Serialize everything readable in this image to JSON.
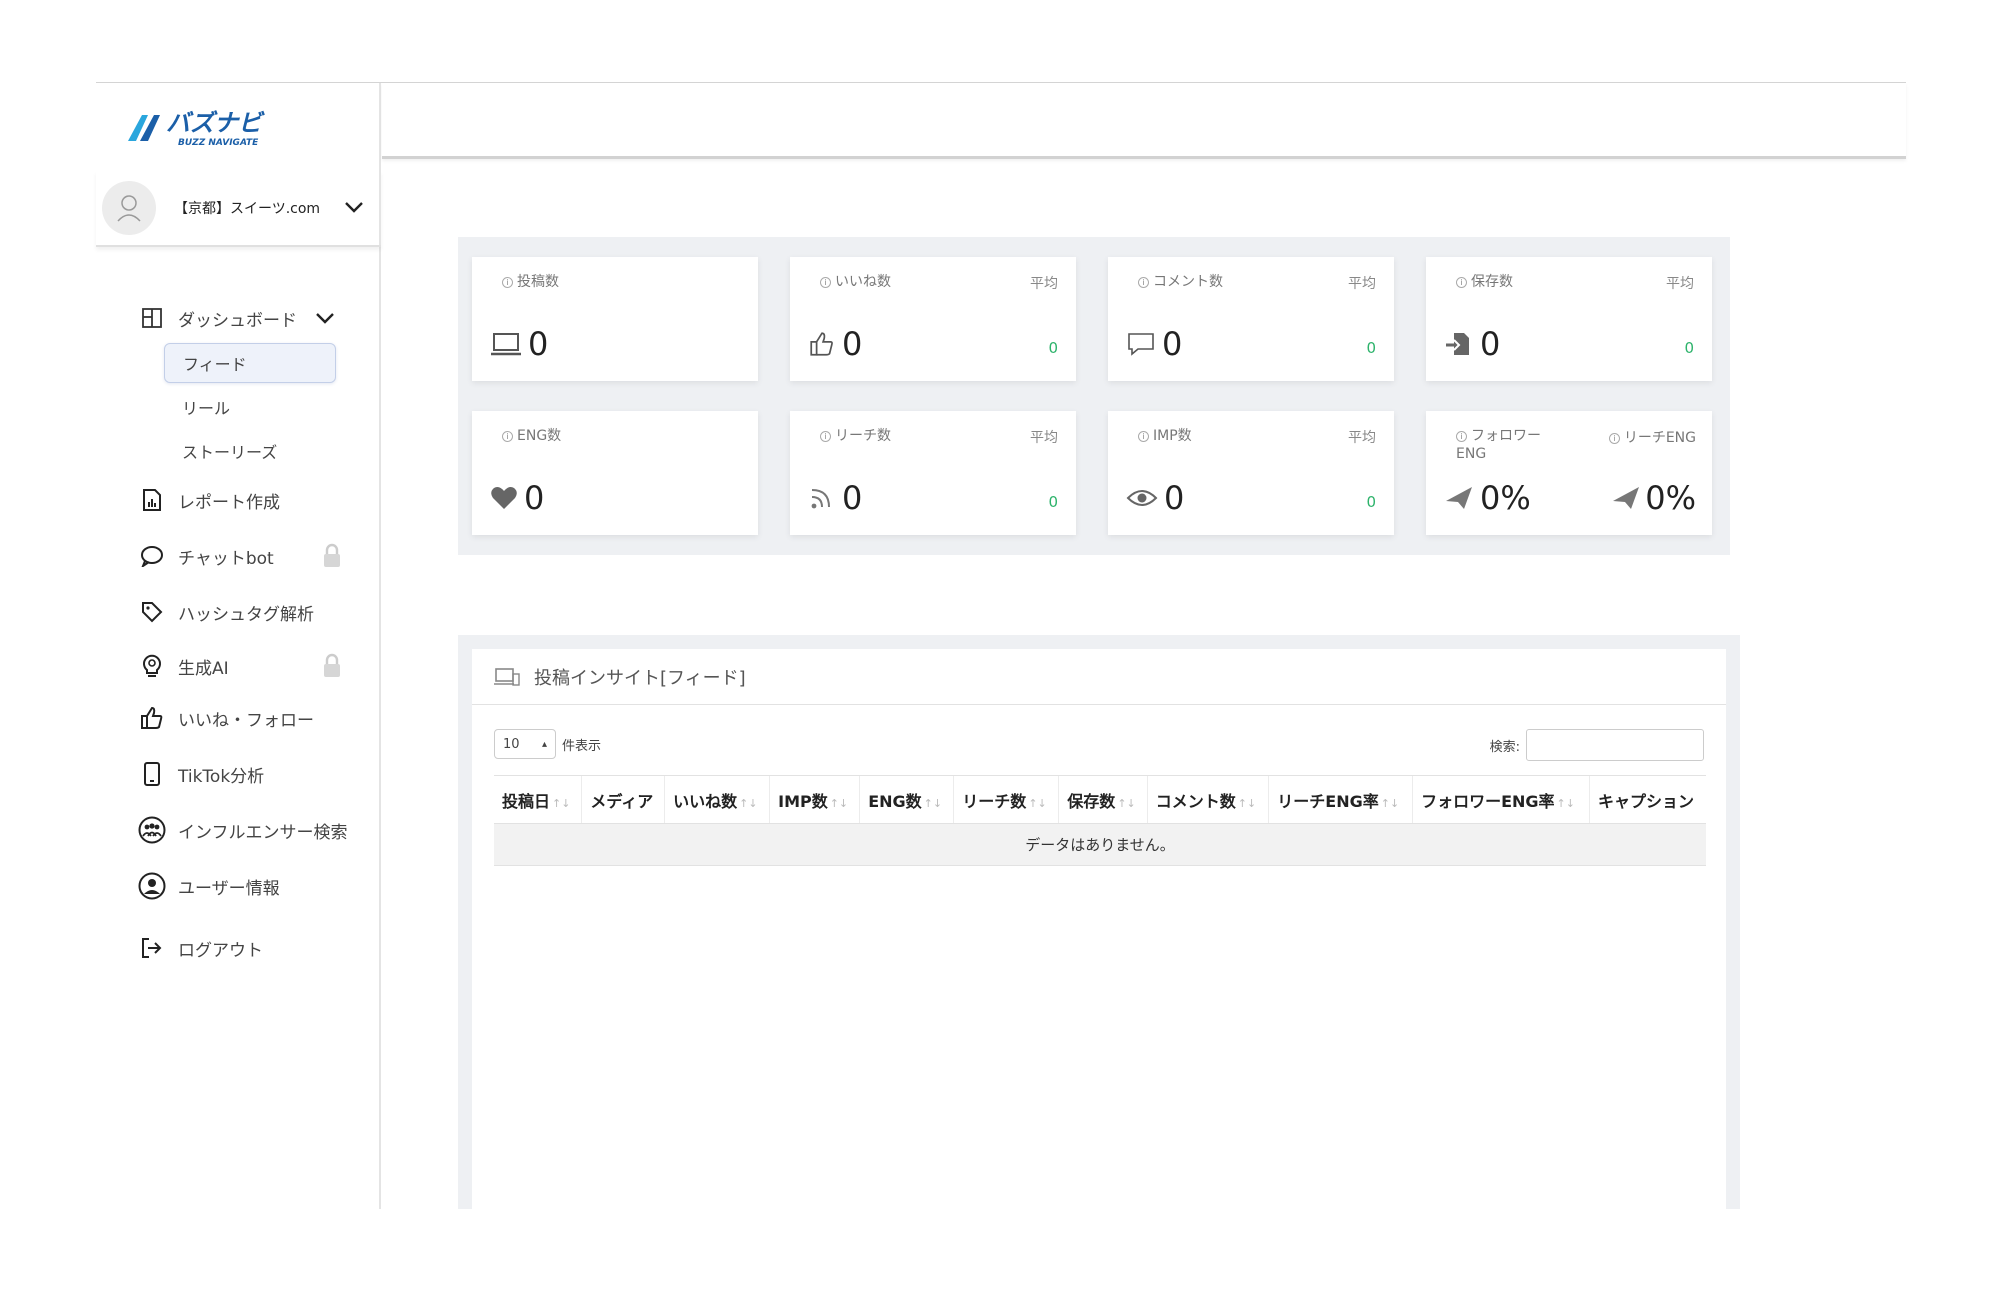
{
  "brand": {
    "logo_text": "バズナビ",
    "logo_sub": "BUZZ NAVIGATE"
  },
  "account": {
    "name": "【京都】スイーツ.com"
  },
  "nav": {
    "dashboard": "ダッシュボード",
    "feed": "フィード",
    "reel": "リール",
    "stories": "ストーリーズ",
    "report": "レポート作成",
    "chatbot": "チャットbot",
    "hashtag": "ハッシュタグ解析",
    "ai": "生成AI",
    "like_follow": "いいね・フォロー",
    "tiktok": "TikTok分析",
    "influencer": "インフルエンサー検索",
    "user_info": "ユーザー情報",
    "logout": "ログアウト"
  },
  "stats": {
    "posts": {
      "label": "投稿数",
      "value": "0"
    },
    "likes": {
      "label": "いいね数",
      "avg_label": "平均",
      "value": "0",
      "avg": "0"
    },
    "comments": {
      "label": "コメント数",
      "avg_label": "平均",
      "value": "0",
      "avg": "0"
    },
    "saves": {
      "label": "保存数",
      "avg_label": "平均",
      "value": "0",
      "avg": "0"
    },
    "eng": {
      "label": "ENG数",
      "value": "0"
    },
    "reach": {
      "label": "リーチ数",
      "avg_label": "平均",
      "value": "0",
      "avg": "0"
    },
    "imp": {
      "label": "IMP数",
      "avg_label": "平均",
      "value": "0",
      "avg": "0"
    },
    "follower_eng": {
      "label": "フォロワーENG",
      "value": "0%"
    },
    "reach_eng": {
      "label": "リーチENG",
      "value": "0%"
    }
  },
  "insight": {
    "title": "投稿インサイト[フィード]",
    "page_length": "10",
    "page_length_suffix": "件表示",
    "search_label": "検索:",
    "search_value": "",
    "columns": [
      "投稿日",
      "メディア",
      "いいね数",
      "IMP数",
      "ENG数",
      "リーチ数",
      "保存数",
      "コメント数",
      "リーチENG率",
      "フォロワーENG率",
      "キャプション"
    ],
    "empty": "データはありません。"
  }
}
